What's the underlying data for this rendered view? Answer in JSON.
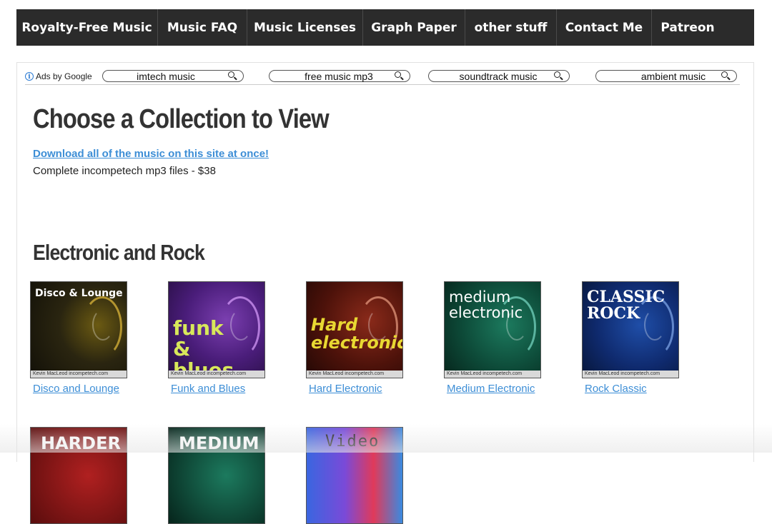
{
  "nav": {
    "items": [
      {
        "label": "Royalty-Free Music"
      },
      {
        "label": "Music FAQ"
      },
      {
        "label": "Music Licenses"
      },
      {
        "label": "Graph Paper"
      },
      {
        "label": "other stuff"
      },
      {
        "label": "Contact Me"
      },
      {
        "label": "Patreon"
      }
    ]
  },
  "ads": {
    "label": "Ads by Google",
    "pills": [
      {
        "label": "imtech music"
      },
      {
        "label": "free music mp3"
      },
      {
        "label": "soundtrack music"
      },
      {
        "label": "ambient music"
      }
    ]
  },
  "main": {
    "title": "Choose a Collection to View",
    "download_link": "Download all of the music on this site at once!",
    "download_sub": "Complete incompetech mp3 files - $38",
    "section_title": "Electronic and Rock",
    "credit": "Kevin MacLeod   incompetech.com",
    "collections": [
      {
        "art": "Disco & Lounge",
        "link": "Disco and Lounge"
      },
      {
        "art": "funk & blues",
        "link": "Funk and Blues"
      },
      {
        "art": "Hard electronic",
        "link": "Hard Electronic"
      },
      {
        "art": "medium electronic",
        "link": "Medium Electronic"
      },
      {
        "art": "CLASSIC ROCK",
        "link": "Rock Classic"
      }
    ],
    "row2": [
      {
        "art": "HARDER"
      },
      {
        "art": "MEDIUM"
      },
      {
        "art": "Video"
      }
    ]
  }
}
